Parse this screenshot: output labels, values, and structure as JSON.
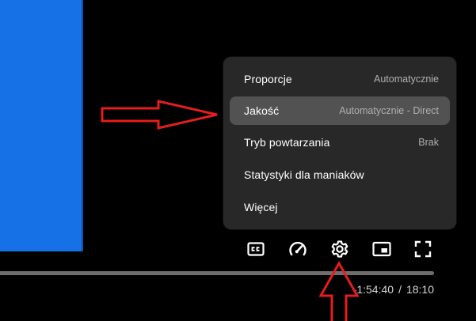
{
  "settings_menu": {
    "items": [
      {
        "label": "Proporcje",
        "value": "Automatycznie",
        "highlighted": false
      },
      {
        "label": "Jakość",
        "value": "Automatycznie - Direct",
        "highlighted": true
      },
      {
        "label": "Tryb powtarzania",
        "value": "Brak",
        "highlighted": false
      },
      {
        "label": "Statystyki dla maniaków",
        "value": "",
        "highlighted": false
      },
      {
        "label": "Więcej",
        "value": "",
        "highlighted": false
      }
    ]
  },
  "controls": {
    "buttons": [
      {
        "name": "subtitles-button",
        "icon": "cc-icon"
      },
      {
        "name": "playback-speed-button",
        "icon": "speedometer-icon"
      },
      {
        "name": "settings-button",
        "icon": "gear-icon"
      },
      {
        "name": "miniplayer-button",
        "icon": "picture-in-picture-icon"
      },
      {
        "name": "fullscreen-button",
        "icon": "fullscreen-icon"
      }
    ]
  },
  "time": {
    "remaining": "-1:54:40",
    "separator": "/",
    "total": "18:10"
  },
  "colors": {
    "video_blue": "#1670e6",
    "menu_background": "#282828",
    "menu_highlight": "#525252",
    "annotation_red": "#e51d1d"
  }
}
